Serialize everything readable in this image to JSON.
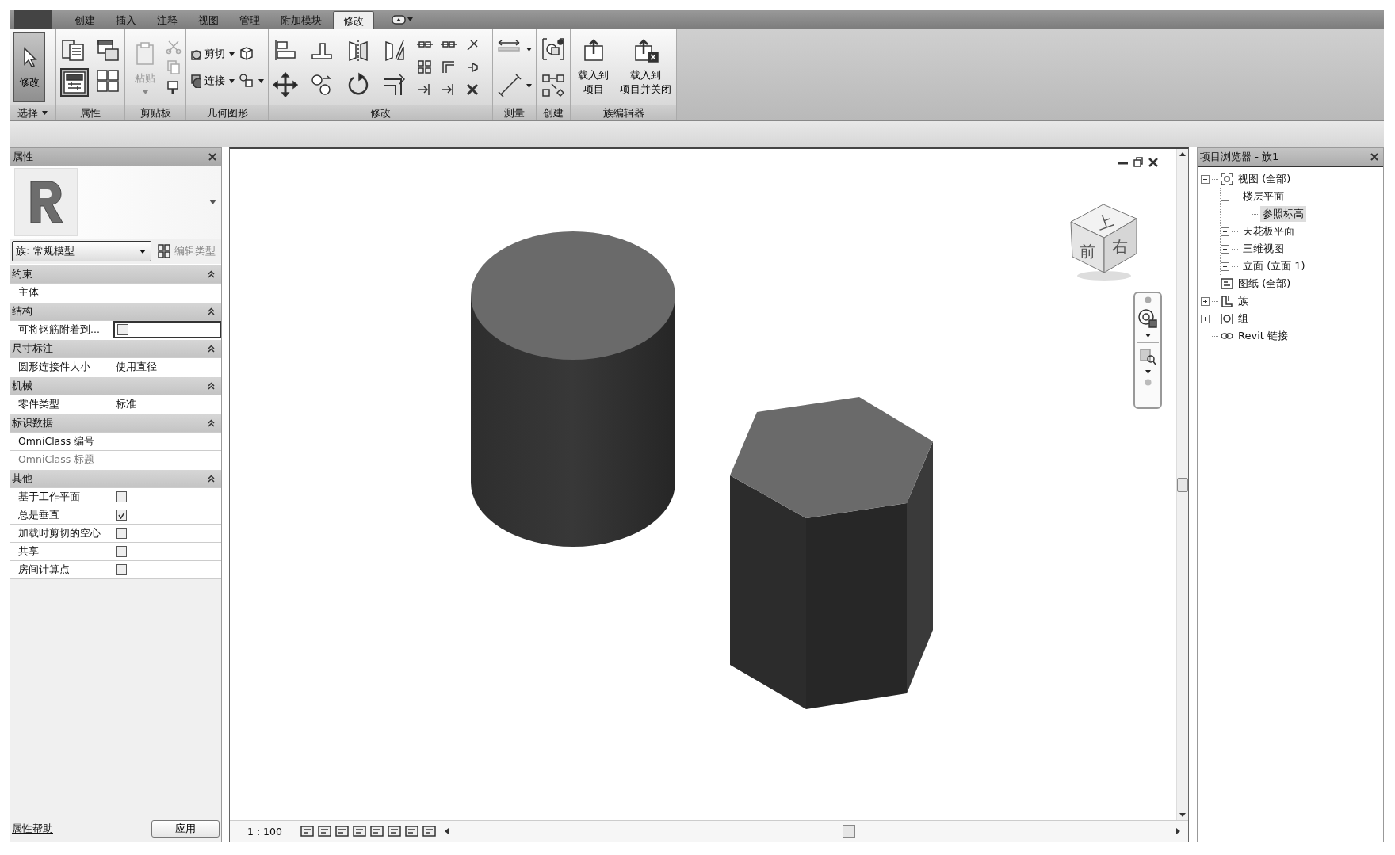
{
  "ribbon": {
    "tabs": [
      {
        "label": "创建",
        "selected": false
      },
      {
        "label": "插入",
        "selected": false
      },
      {
        "label": "注释",
        "selected": false
      },
      {
        "label": "视图",
        "selected": false
      },
      {
        "label": "管理",
        "selected": false
      },
      {
        "label": "附加模块",
        "selected": false
      },
      {
        "label": "修改",
        "selected": true
      }
    ],
    "panels": [
      {
        "kind": "select",
        "label": "选择",
        "buttons": [
          {
            "label": "修改",
            "selected": true
          }
        ]
      },
      {
        "kind": "properties",
        "label": "属性"
      },
      {
        "kind": "clipboard",
        "label": "剪贴板",
        "buttons": [
          {
            "label": "粘贴",
            "disabled": true
          }
        ]
      },
      {
        "kind": "geometry",
        "label": "几何图形",
        "buttons": [
          {
            "label": "剪切",
            "disabled": false
          },
          {
            "label": "连接",
            "disabled": false
          }
        ]
      },
      {
        "kind": "modify",
        "label": "修改"
      },
      {
        "kind": "measure",
        "label": "测量"
      },
      {
        "kind": "create",
        "label": "创建"
      },
      {
        "kind": "family-editor",
        "label": "族编辑器",
        "buttons": [
          {
            "lines": [
              "载入到",
              "项目"
            ],
            "disabled": false
          },
          {
            "lines": [
              "载入到",
              "项目并关闭"
            ],
            "disabled": false
          }
        ]
      }
    ]
  },
  "properties": {
    "title": "属性",
    "type_selector": "族: 常规模型",
    "edit_type": {
      "label": "编辑类型",
      "disabled": true
    },
    "groups": [
      {
        "label": "约束",
        "expanded": true,
        "rows": [
          {
            "name": "主体",
            "kind": "text",
            "disabled": false,
            "active": false
          }
        ]
      },
      {
        "label": "结构",
        "expanded": true,
        "rows": [
          {
            "name": "可将钢筋附着到...",
            "kind": "checkbox",
            "checked": false,
            "disabled": false,
            "active": true
          }
        ]
      },
      {
        "label": "尺寸标注",
        "expanded": true,
        "rows": [
          {
            "name": "圆形连接件大小",
            "kind": "text",
            "value": "使用直径",
            "disabled": false,
            "active": false
          }
        ]
      },
      {
        "label": "机械",
        "expanded": true,
        "rows": [
          {
            "name": "零件类型",
            "kind": "text",
            "value": "标准",
            "disabled": false,
            "active": false
          }
        ]
      },
      {
        "label": "标识数据",
        "expanded": true,
        "rows": [
          {
            "name": "OmniClass 编号",
            "kind": "text",
            "disabled": false,
            "active": false
          },
          {
            "name": "OmniClass 标题",
            "kind": "text",
            "disabled": true,
            "active": false
          }
        ]
      },
      {
        "label": "其他",
        "expanded": true,
        "rows": [
          {
            "name": "基于工作平面",
            "kind": "checkbox",
            "checked": false,
            "disabled": false,
            "active": false
          },
          {
            "name": "总是垂直",
            "kind": "checkbox",
            "checked": true,
            "disabled": false,
            "active": false
          },
          {
            "name": "加载时剪切的空心",
            "kind": "checkbox",
            "checked": false,
            "disabled": false,
            "active": false
          },
          {
            "name": "共享",
            "kind": "checkbox",
            "checked": false,
            "disabled": false,
            "active": false
          },
          {
            "name": "房间计算点",
            "kind": "checkbox",
            "checked": false,
            "disabled": false,
            "active": false
          }
        ]
      }
    ],
    "help_link": "属性帮助",
    "apply_button": "应用"
  },
  "viewport": {
    "view_cube": {
      "top": "上",
      "front": "前",
      "right": "右"
    },
    "scale": "1 : 100"
  },
  "project_browser": {
    "title": "项目浏览器 - 族1",
    "tree": [
      {
        "label": "视图 (全部)",
        "kind": "views",
        "expanded": true,
        "selected": false,
        "children": [
          {
            "label": "楼层平面",
            "expanded": true,
            "selected": false,
            "children": [
              {
                "label": "参照标高",
                "selected": true
              }
            ]
          },
          {
            "label": "天花板平面",
            "expanded": false,
            "selected": false
          },
          {
            "label": "三维视图",
            "expanded": false,
            "selected": false
          },
          {
            "label": "立面 (立面 1)",
            "expanded": false,
            "selected": false
          }
        ]
      },
      {
        "label": "图纸 (全部)",
        "kind": "sheets",
        "selected": false
      },
      {
        "label": "族",
        "kind": "families",
        "expanded": false,
        "selected": false
      },
      {
        "label": "组",
        "kind": "groups",
        "expanded": false,
        "selected": false
      },
      {
        "label": "Revit 链接",
        "kind": "links",
        "selected": false
      }
    ]
  }
}
